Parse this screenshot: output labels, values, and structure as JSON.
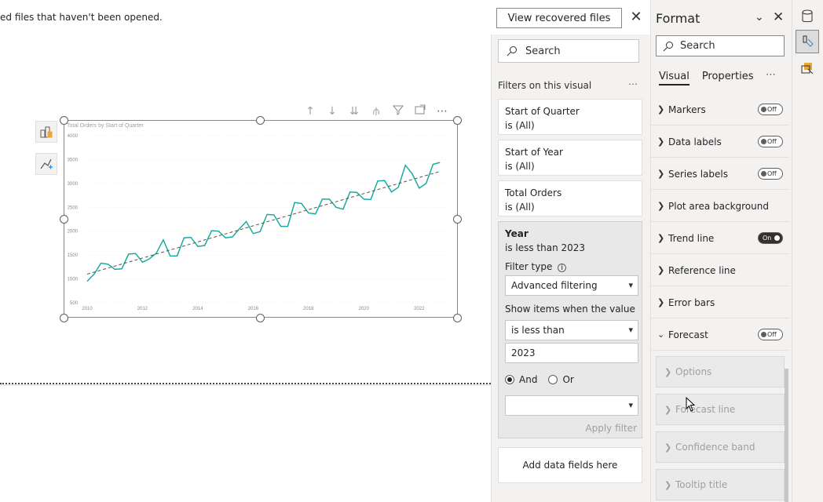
{
  "notice": {
    "text": "ed files that haven't been opened.",
    "button_label": "View recovered files",
    "close_glyph": "✕"
  },
  "visual": {
    "header_icons": [
      "arrow-up-icon",
      "arrow-down-icon",
      "double-arrow-down-icon",
      "expand-hierarchy-icon",
      "filter-icon",
      "focus-mode-icon",
      "more-options-icon"
    ],
    "more_glyph": "⋯"
  },
  "chart_data": {
    "type": "line",
    "title": "Total Orders by Start of Quarter",
    "xlabel": "",
    "ylabel": "",
    "x_ticks": [
      "2010",
      "2012",
      "2014",
      "2016",
      "2018",
      "2020",
      "2022"
    ],
    "y_ticks": [
      500,
      1000,
      1500,
      2000,
      2500,
      3000,
      3500,
      4000
    ],
    "ylim": [
      500,
      4000
    ],
    "xlim": [
      2010,
      2023
    ],
    "grid": true,
    "series": [
      {
        "color": "#1aaba0",
        "x": [
          2010.0,
          2010.25,
          2010.5,
          2010.75,
          2011.0,
          2011.25,
          2011.5,
          2011.75,
          2012.0,
          2012.25,
          2012.5,
          2012.75,
          2013.0,
          2013.25,
          2013.5,
          2013.75,
          2014.0,
          2014.25,
          2014.5,
          2014.75,
          2015.0,
          2015.25,
          2015.5,
          2015.75,
          2016.0,
          2016.25,
          2016.5,
          2016.75,
          2017.0,
          2017.25,
          2017.5,
          2017.75,
          2018.0,
          2018.25,
          2018.5,
          2018.75,
          2019.0,
          2019.25,
          2019.5,
          2019.75,
          2020.0,
          2020.25,
          2020.5,
          2020.75,
          2021.0,
          2021.25,
          2021.5,
          2021.75,
          2022.0,
          2022.25,
          2022.5,
          2022.75
        ],
        "values": [
          950,
          1100,
          1330,
          1310,
          1200,
          1210,
          1520,
          1530,
          1350,
          1420,
          1540,
          1820,
          1480,
          1480,
          1860,
          1870,
          1680,
          1700,
          2010,
          2000,
          1860,
          1880,
          2050,
          2200,
          1950,
          1990,
          2350,
          2340,
          2100,
          2100,
          2600,
          2580,
          2380,
          2360,
          2670,
          2670,
          2500,
          2460,
          2820,
          2810,
          2670,
          2660,
          3050,
          3060,
          2820,
          2920,
          3380,
          3200,
          2900,
          3000,
          3400,
          3440
        ]
      },
      {
        "name": "",
        "style": "dashed",
        "color": "#555555",
        "x": [
          2010.0,
          2022.75
        ],
        "values": [
          1100,
          3250
        ]
      }
    ]
  },
  "filter_pane": {
    "search_placeholder": "Search",
    "heading": "Filters on this visual",
    "more_glyph": "⋯",
    "cards": [
      {
        "title": "Start of Quarter",
        "sub": "is (All)"
      },
      {
        "title": "Start of Year",
        "sub": "is (All)"
      },
      {
        "title": "Total Orders",
        "sub": "is (All)"
      }
    ],
    "year_card": {
      "title": "Year",
      "sub": "is less than 2023",
      "filter_type_label": "Filter type",
      "filter_type_value": "Advanced filtering",
      "show_items_label": "Show items when the value",
      "condition_value": "is less than",
      "input_value": "2023",
      "and_label": "And",
      "or_label": "Or",
      "second_condition_value": "",
      "apply_label": "Apply filter"
    },
    "add_fields_label": "Add data fields here"
  },
  "format_pane": {
    "title": "Format",
    "search_placeholder": "Search",
    "tabs": [
      "Visual",
      "Properties"
    ],
    "more_glyph": "⋯",
    "rows": [
      {
        "label": "Markers",
        "toggle": "Off"
      },
      {
        "label": "Data labels",
        "toggle": "Off"
      },
      {
        "label": "Series labels",
        "toggle": "Off"
      },
      {
        "label": "Plot area background",
        "toggle": ""
      },
      {
        "label": "Trend line",
        "toggle": "On"
      },
      {
        "label": "Reference line",
        "toggle": ""
      },
      {
        "label": "Error bars",
        "toggle": ""
      },
      {
        "label": "Forecast",
        "toggle": "Off"
      }
    ],
    "forecast_sections": [
      "Options",
      "Forecast line",
      "Confidence band",
      "Tooltip title"
    ]
  },
  "colors": {
    "accent": "#1aaba0",
    "pane_bg": "#f3f2f1",
    "format_icon": "#e8a838"
  }
}
